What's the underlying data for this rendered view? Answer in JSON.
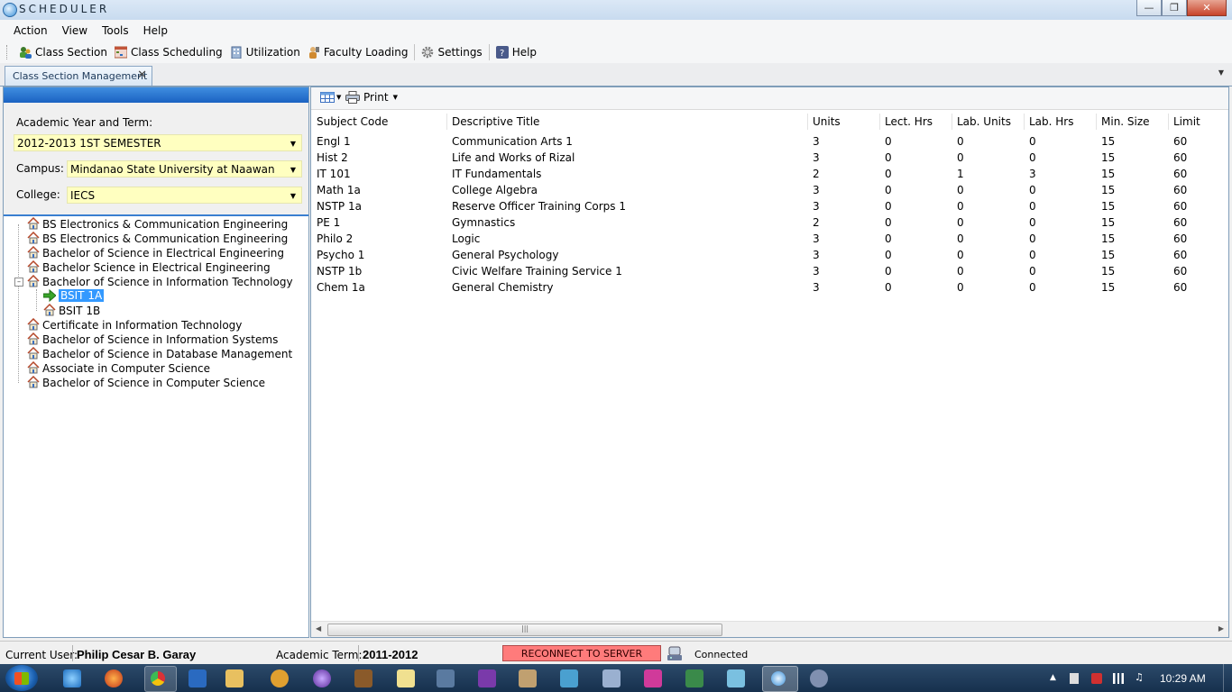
{
  "window": {
    "title": "SCHEDULER"
  },
  "menu": [
    "Action",
    "View",
    "Tools",
    "Help"
  ],
  "toolbar": {
    "items": [
      {
        "label": "Class Section",
        "icon": "users-icon"
      },
      {
        "label": "Class Scheduling",
        "icon": "calendar-icon"
      },
      {
        "label": "Utilization",
        "icon": "building-icon"
      },
      {
        "label": "Faculty Loading",
        "icon": "faculty-icon"
      },
      {
        "label": "Settings",
        "icon": "gear-icon"
      },
      {
        "label": "Help",
        "icon": "help-icon"
      }
    ]
  },
  "tabs": {
    "active": "Class Section Management"
  },
  "filters": {
    "term_label": "Academic Year and Term:",
    "term_value": "2012-2013 1ST SEMESTER",
    "campus_label": "Campus:",
    "campus_value": "Mindanao State University at Naawan",
    "college_label": "College:",
    "college_value": "IECS"
  },
  "tree": [
    "BS Electronics & Communication Engineering",
    "BS Electronics & Communication Engineering",
    "Bachelor of Science in Electrical Engineering",
    "Bachelor Science in Electrical Engineering",
    "Bachelor of Science in Information Technology",
    "BSIT 1A",
    "BSIT 1B",
    "Certificate in Information Technology",
    "Bachelor of Science in Information Systems",
    "Bachelor of Science in Database Management",
    "Associate in Computer Science",
    "Bachelor of Science in Computer Science"
  ],
  "grid_toolbar": {
    "print_label": "Print"
  },
  "grid": {
    "columns": [
      "Subject Code",
      "Descriptive Title",
      "Units",
      "Lect. Hrs",
      "Lab. Units",
      "Lab. Hrs",
      "Min. Size",
      "Limit"
    ],
    "rows": [
      [
        "Engl 1",
        "Communication Arts 1",
        "3",
        "0",
        "0",
        "0",
        "15",
        "60"
      ],
      [
        "Hist 2",
        "Life and Works of Rizal",
        "3",
        "0",
        "0",
        "0",
        "15",
        "60"
      ],
      [
        "IT 101",
        "IT Fundamentals",
        "2",
        "0",
        "1",
        "3",
        "15",
        "60"
      ],
      [
        "Math 1a",
        "College Algebra",
        "3",
        "0",
        "0",
        "0",
        "15",
        "60"
      ],
      [
        "NSTP 1a",
        "Reserve Officer Training Corps 1",
        "3",
        "0",
        "0",
        "0",
        "15",
        "60"
      ],
      [
        "PE 1",
        "Gymnastics",
        "2",
        "0",
        "0",
        "0",
        "15",
        "60"
      ],
      [
        "Philo 2",
        "Logic",
        "3",
        "0",
        "0",
        "0",
        "15",
        "60"
      ],
      [
        "Psycho 1",
        "General Psychology",
        "3",
        "0",
        "0",
        "0",
        "15",
        "60"
      ],
      [
        "NSTP 1b",
        "Civic Welfare Training Service 1",
        "3",
        "0",
        "0",
        "0",
        "15",
        "60"
      ],
      [
        "Chem 1a",
        "General Chemistry",
        "3",
        "0",
        "0",
        "0",
        "15",
        "60"
      ]
    ]
  },
  "status": {
    "user_label": "Current User:",
    "user_value": "Philip Cesar B. Garay",
    "term_label": "Academic Term:",
    "term_value": "2011-2012",
    "reconnect_label": "RECONNECT TO SERVER",
    "connection": "Connected"
  },
  "taskbar": {
    "clock": "10:29 AM"
  }
}
